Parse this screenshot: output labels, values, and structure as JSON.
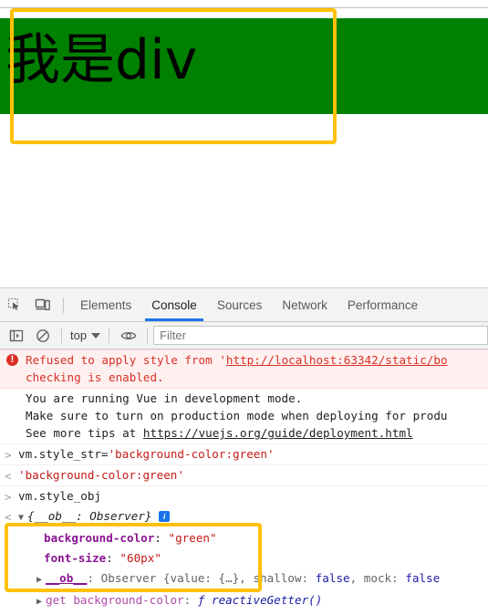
{
  "page": {
    "div_text": "我是div",
    "div_background": "#008000",
    "div_font_size": "60px"
  },
  "highlight_color": "#ffc107",
  "devtools": {
    "toolbar": {
      "inspect_icon": "inspect-element-icon",
      "device_icon": "device-toolbar-icon",
      "tabs": [
        {
          "label": "Elements",
          "active": false
        },
        {
          "label": "Console",
          "active": true
        },
        {
          "label": "Sources",
          "active": false
        },
        {
          "label": "Network",
          "active": false
        },
        {
          "label": "Performance",
          "active": false
        }
      ],
      "active_tab_color": "#1a73e8"
    },
    "filterbar": {
      "sidebar_icon": "console-sidebar-icon",
      "clear_icon": "clear-console-icon",
      "context_label": "top",
      "eye_icon": "live-expression-eye-icon",
      "filter_placeholder": "Filter",
      "filter_value": ""
    },
    "console": {
      "messages": [
        {
          "type": "error",
          "badge": "!",
          "text_before_link": "Refused to apply style from ",
          "quote": "'",
          "link": "http://localhost:63342/static/bo",
          "text_after": "checking is enabled."
        },
        {
          "type": "info",
          "lines": [
            "You are running Vue in development mode.",
            "Make sure to turn on production mode when deploying for produ",
            "See more tips at "
          ],
          "link": "https://vuejs.org/guide/deployment.html"
        },
        {
          "type": "input",
          "arrow": ">",
          "expr_plain": "vm.style_str=",
          "expr_string": "'background-color:green'"
        },
        {
          "type": "output",
          "arrow": "<",
          "value_string": "'background-color:green'"
        },
        {
          "type": "input",
          "arrow": ">",
          "expr_plain": "vm.style_obj"
        },
        {
          "type": "object-output",
          "arrow": "<",
          "disclosure": "▼",
          "summary": "{__ob__: Observer}",
          "info_badge": "i",
          "props": [
            {
              "key": "background-color",
              "sep": ": ",
              "value": "\"green\""
            },
            {
              "key": "font-size",
              "sep": ": ",
              "value": "\"60px\""
            }
          ],
          "ob_line": {
            "disclosure": "▶",
            "key": "__ob__",
            "rest_1": ": Observer {value: {…}, shallow: ",
            "false_1": "false",
            "rest_2": ", mock: ",
            "false_2": "false"
          },
          "getter_line": {
            "disclosure": "▶",
            "text": "get background-color",
            "sep": ": ",
            "fn_glyph": "ƒ",
            "fn_name": "reactiveGetter()"
          }
        }
      ]
    }
  }
}
